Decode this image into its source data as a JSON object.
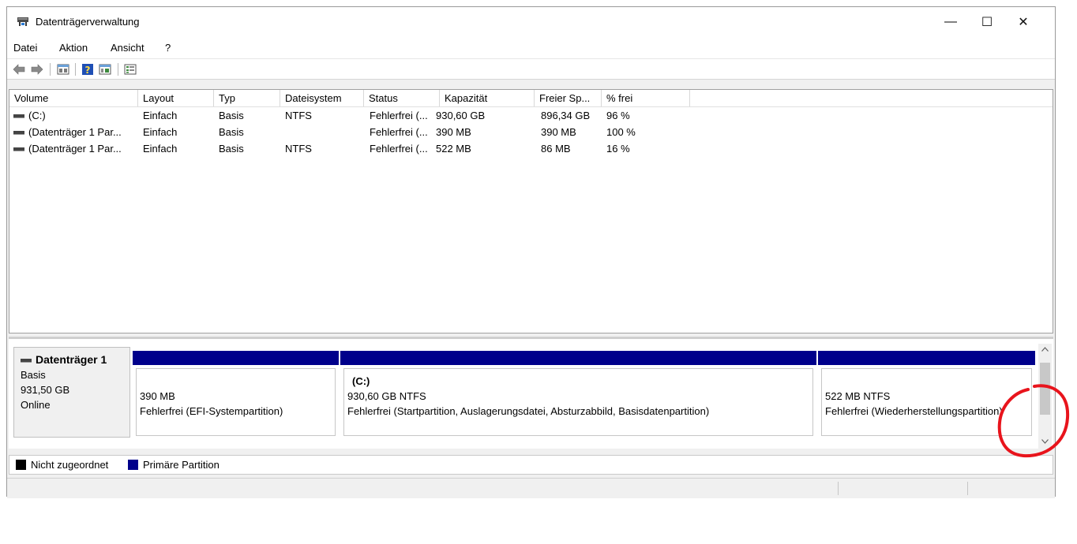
{
  "window": {
    "title": "Datenträgerverwaltung",
    "minimize": "—",
    "maximize": "☐",
    "close": "✕"
  },
  "menu": [
    "Datei",
    "Aktion",
    "Ansicht",
    "?"
  ],
  "toolbar": [
    "back-arrow-icon",
    "forward-arrow-icon",
    "properties-icon",
    "help-icon",
    "console-tree-icon",
    "settings-list-icon"
  ],
  "columns": [
    "Volume",
    "Layout",
    "Typ",
    "Dateisystem",
    "Status",
    "Kapazität",
    "Freier Sp...",
    "% frei"
  ],
  "rows": [
    [
      "(C:)",
      "Einfach",
      "Basis",
      "NTFS",
      "Fehlerfrei (...",
      "930,60 GB",
      "896,34 GB",
      "96 %"
    ],
    [
      "(Datenträger 1 Par...",
      "Einfach",
      "Basis",
      "",
      "Fehlerfrei (...",
      "390 MB",
      "390 MB",
      "100 %"
    ],
    [
      "(Datenträger 1 Par...",
      "Einfach",
      "Basis",
      "NTFS",
      "Fehlerfrei (...",
      "522 MB",
      "86 MB",
      "16 %"
    ]
  ],
  "disk": {
    "name": "Datenträger 1",
    "type": "Basis",
    "size": "931,50 GB",
    "state": "Online",
    "partitions": [
      {
        "label": "",
        "size": "390 MB",
        "status": "Fehlerfrei (EFI-Systempartition)"
      },
      {
        "label": "(C:)",
        "size": "930,60 GB NTFS",
        "status": "Fehlerfrei (Startpartition, Auslagerungsdatei, Absturzabbild, Basisdatenpartition)"
      },
      {
        "label": "",
        "size": "522 MB NTFS",
        "status": "Fehlerfrei (Wiederherstellungspartition)"
      }
    ]
  },
  "legend": {
    "unallocated": "Nicht zugeordnet",
    "primary": "Primäre Partition"
  },
  "colors": {
    "primary_partition": "#00008b",
    "unallocated": "#000000",
    "annotation": "#e8141c"
  }
}
